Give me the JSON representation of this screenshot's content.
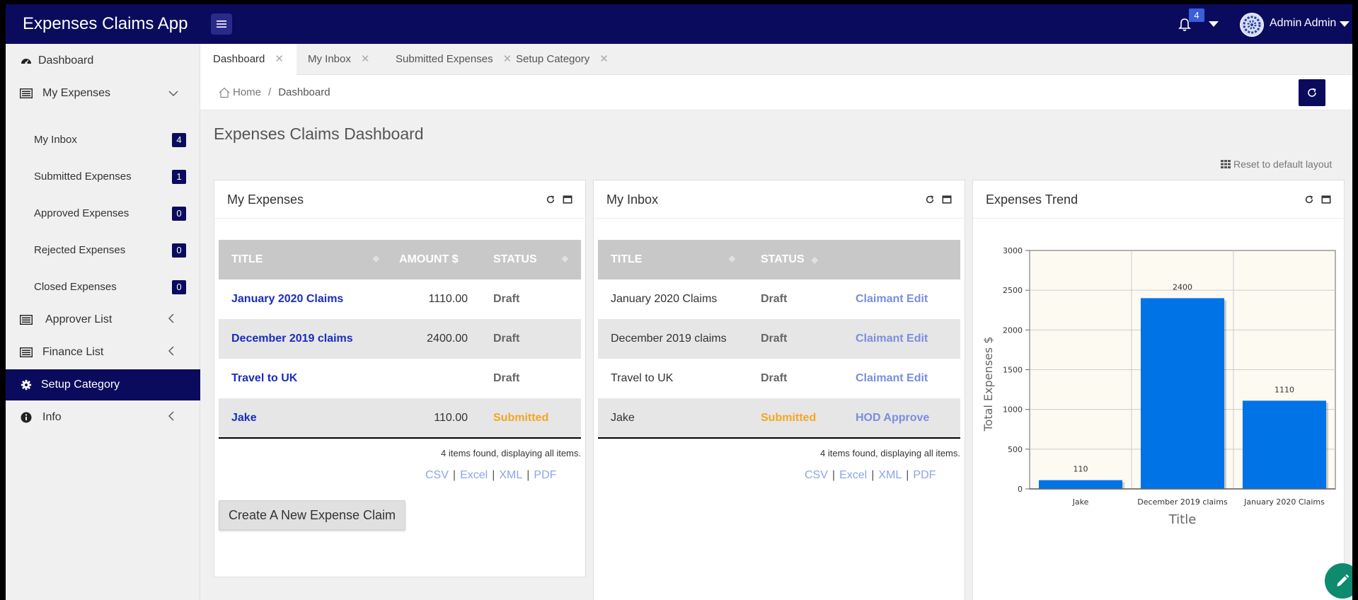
{
  "app": {
    "title": "Expenses Claims App"
  },
  "topbar": {
    "notification_count": "4",
    "user_name": "Admin Admin"
  },
  "sidebar": {
    "items": [
      {
        "label": "Dashboard",
        "icon": "dashboard-icon"
      },
      {
        "label": "My Expenses",
        "icon": "list-icon"
      },
      {
        "label": "Approver List",
        "icon": "list-icon"
      },
      {
        "label": "Finance List",
        "icon": "list-icon"
      },
      {
        "label": "Setup Category",
        "icon": "gear-icon"
      },
      {
        "label": "Info",
        "icon": "info-icon"
      }
    ],
    "sub_items": [
      {
        "label": "My Inbox",
        "count": "4"
      },
      {
        "label": "Submitted Expenses",
        "count": "1"
      },
      {
        "label": "Approved Expenses",
        "count": "0"
      },
      {
        "label": "Rejected Expenses",
        "count": "0"
      },
      {
        "label": "Closed Expenses",
        "count": "0"
      }
    ]
  },
  "tabs": [
    {
      "label": "Dashboard"
    },
    {
      "label": "My Inbox"
    },
    {
      "label": "Submitted Expenses"
    },
    {
      "label": "Setup Category"
    }
  ],
  "breadcrumb": {
    "home": "Home",
    "separator": "/",
    "current": "Dashboard"
  },
  "page": {
    "title": "Expenses Claims Dashboard",
    "reset_layout": "Reset to default layout"
  },
  "my_expenses": {
    "title": "My Expenses",
    "columns": [
      "TITLE",
      "AMOUNT $",
      "STATUS"
    ],
    "rows": [
      {
        "title": "January 2020 Claims",
        "amount": "1110.00",
        "status": "Draft"
      },
      {
        "title": "December 2019 claims",
        "amount": "2400.00",
        "status": "Draft"
      },
      {
        "title": "Travel to UK",
        "amount": "",
        "status": "Draft"
      },
      {
        "title": "Jake",
        "amount": "110.00",
        "status": "Submitted"
      }
    ],
    "found": "4 items found, displaying all items.",
    "exports": [
      "CSV",
      "Excel",
      "XML",
      "PDF"
    ],
    "create_button": "Create A New Expense Claim"
  },
  "my_inbox": {
    "title": "My Inbox",
    "columns": [
      "TITLE",
      "STATUS"
    ],
    "rows": [
      {
        "title": "January 2020 Claims",
        "status": "Draft",
        "action": "Claimant Edit"
      },
      {
        "title": "December 2019 claims",
        "status": "Draft",
        "action": "Claimant Edit"
      },
      {
        "title": "Travel to UK",
        "status": "Draft",
        "action": "Claimant Edit"
      },
      {
        "title": "Jake",
        "status": "Submitted",
        "action": "HOD Approve"
      }
    ],
    "found": "4 items found, displaying all items.",
    "exports": [
      "CSV",
      "Excel",
      "XML",
      "PDF"
    ]
  },
  "expenses_trend": {
    "title": "Expenses Trend"
  },
  "chart_data": {
    "type": "bar",
    "categories": [
      "Jake",
      "December 2019 claims",
      "January 2020 Claims"
    ],
    "values": [
      110,
      2400,
      1110
    ],
    "xlabel": "Title",
    "ylabel": "Total Expenses $",
    "ylim": [
      0,
      3000
    ],
    "yticks": [
      0,
      500,
      1000,
      1500,
      2000,
      2500,
      3000
    ],
    "bar_color": "#0073e6",
    "grid": true
  },
  "colors": {
    "navy": "#0b0b5e",
    "link": "#1a2dbf",
    "submitted": "#f5a623",
    "action": "#7b8de0",
    "bar": "#0073e6"
  }
}
